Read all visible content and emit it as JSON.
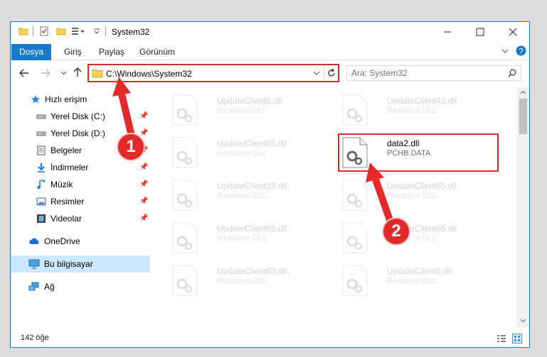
{
  "window": {
    "title": "System32",
    "minimize_icon": "minimize-icon",
    "maximize_icon": "maximize-icon",
    "close_icon": "close-icon"
  },
  "ribbon": {
    "tabs": [
      {
        "label": "Dosya"
      },
      {
        "label": "Giriş"
      },
      {
        "label": "Paylaş"
      },
      {
        "label": "Görünüm"
      }
    ]
  },
  "address": {
    "path": "C:\\Windows\\System32",
    "search_placeholder": "Ara: System32"
  },
  "sidebar": {
    "items": [
      {
        "label": "Hızlı erişim",
        "icon": "star-icon",
        "pinned": false
      },
      {
        "label": "Yerel Disk (C:)",
        "icon": "drive-icon",
        "pinned": true
      },
      {
        "label": "Yerel Disk (D:)",
        "icon": "drive-icon",
        "pinned": true
      },
      {
        "label": "Belgeler",
        "icon": "document-icon",
        "pinned": true
      },
      {
        "label": "İndirmeler",
        "icon": "download-icon",
        "pinned": true
      },
      {
        "label": "Müzik",
        "icon": "music-icon",
        "pinned": true
      },
      {
        "label": "Resimler",
        "icon": "pictures-icon",
        "pinned": true
      },
      {
        "label": "Videolar",
        "icon": "video-icon",
        "pinned": true
      },
      {
        "label": "OneDrive",
        "icon": "cloud-icon",
        "pinned": false
      },
      {
        "label": "Bu bilgisayar",
        "icon": "computer-icon",
        "pinned": false
      },
      {
        "label": "Ağ",
        "icon": "network-icon",
        "pinned": false
      }
    ]
  },
  "files": {
    "left": [
      {
        "name": "UpdateClient5.dll",
        "type": "Resource DLL"
      },
      {
        "name": "UpdateClient65.dll",
        "type": "Resource DLL"
      },
      {
        "name": "UpdateClient19.dll",
        "type": "Resource DLL"
      },
      {
        "name": "UpdateClient65.dll",
        "type": "Resource DLL"
      },
      {
        "name": "UpdateClient63.dll",
        "type": "Resource DLL"
      }
    ],
    "right": [
      {
        "name": "UpdateClient42.dll",
        "type": "Resource DLL"
      },
      {
        "name": "data2.dll",
        "type": "PCHB.DATA"
      },
      {
        "name": "UpdateClient65.dll",
        "type": "Resource DLL"
      },
      {
        "name": "UpdateClient65.dll",
        "type": "Resource DLL"
      },
      {
        "name": "UpdateClient5.dll",
        "type": "Resource DLL"
      }
    ]
  },
  "status": {
    "item_count": "142 öğe"
  },
  "callouts": {
    "one": "1",
    "two": "2"
  },
  "colors": {
    "accent": "#1979ca",
    "highlight": "#e32a2a",
    "selected": "#cce8ff"
  }
}
